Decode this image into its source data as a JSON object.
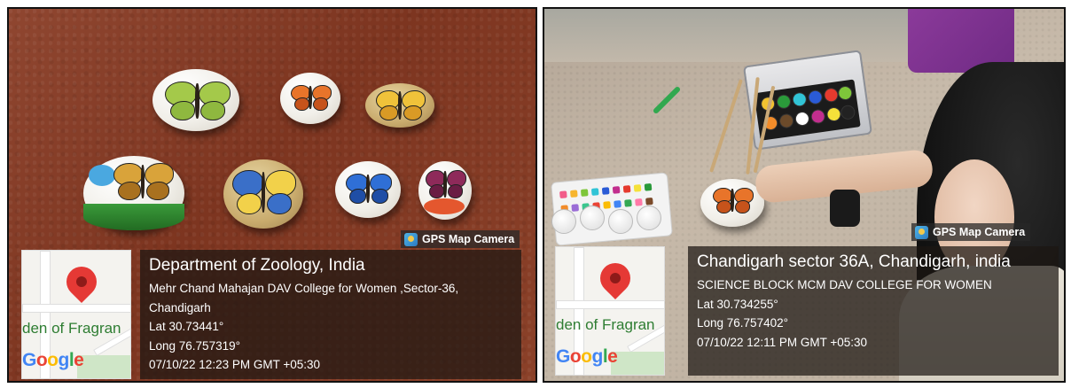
{
  "panels": [
    {
      "gps_tag": "GPS Map Camera",
      "map": {
        "place_label": "den of Fragran",
        "brand": "Google"
      },
      "info": {
        "title": "Department of Zoology, India",
        "lines": [
          "Mehr Chand Mahajan DAV College for Women ,Sector-36,",
          "Chandigarh",
          "Lat 30.73441°",
          "Long 76.757319°",
          "07/10/22 12:23 PM GMT +05:30"
        ]
      }
    },
    {
      "gps_tag": "GPS Map Camera",
      "map": {
        "place_label": "den of Fragran",
        "brand": "Google"
      },
      "info": {
        "title": "Chandigarh sector 36A, Chandigarh, india",
        "lines": [
          "SCIENCE BLOCK MCM DAV COLLEGE FOR WOMEN",
          "Lat 30.734255°",
          "Long 76.757402°",
          "07/10/22 12:11 PM GMT +05:30"
        ]
      }
    }
  ],
  "icons": {
    "gps_logo": "gps-map-camera-icon",
    "map_pin": "map-pin-icon"
  },
  "colors": {
    "pin": "#e53935",
    "overlay": "#1c1612",
    "google_blue": "#4285f4",
    "google_red": "#ea4335",
    "google_yellow": "#fbbc05",
    "google_green": "#34a853"
  }
}
